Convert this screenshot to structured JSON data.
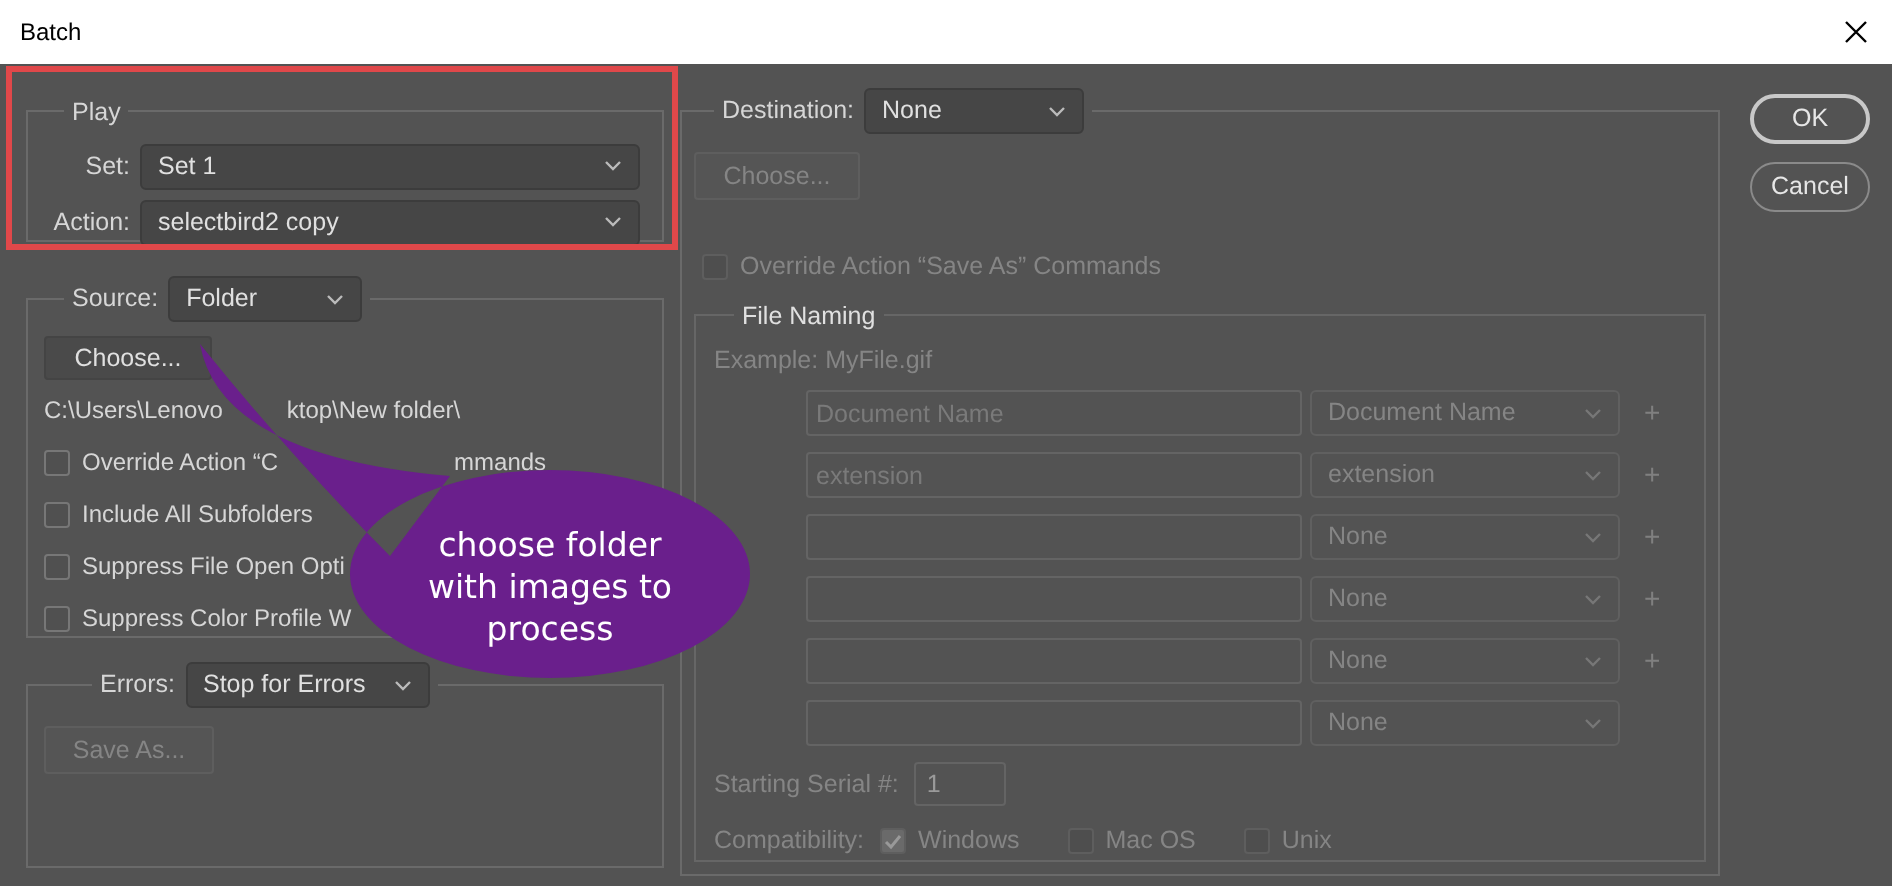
{
  "window": {
    "title": "Batch"
  },
  "play": {
    "legend": "Play",
    "set": {
      "label": "Set:",
      "value": "Set 1"
    },
    "action": {
      "label": "Action:",
      "value": "selectbird2 copy"
    }
  },
  "source": {
    "label": "Source:",
    "value": "Folder",
    "choose": "Choose...",
    "path_parts": [
      "C:\\Users\\Lenovo",
      "ktop\\New folder\\"
    ],
    "options": [
      {
        "label_parts": [
          "Override Action “C",
          "mmands"
        ],
        "checked": false
      },
      {
        "label_parts": [
          "Include All Subfolders"
        ],
        "checked": false
      },
      {
        "label_parts": [
          "Suppress File Open Opti"
        ],
        "checked": false
      },
      {
        "label_parts": [
          "Suppress Color Profile W"
        ],
        "checked": false
      }
    ]
  },
  "errors": {
    "label": "Errors:",
    "value": "Stop for Errors",
    "save_as": {
      "label": "Save As...",
      "disabled": true
    }
  },
  "destination": {
    "label": "Destination:",
    "value": "None",
    "choose": {
      "label": "Choose...",
      "disabled": true
    },
    "override": {
      "label": "Override Action “Save As” Commands",
      "checked": false,
      "disabled": true
    },
    "file_naming": {
      "legend": "File Naming",
      "example": "Example: MyFile.gif",
      "disabled": true,
      "rows": [
        {
          "placeholder": "Document Name",
          "value": "Document Name",
          "plus": "+"
        },
        {
          "placeholder": "extension",
          "value": "extension",
          "plus": "+"
        },
        {
          "value": "None",
          "plus": "+"
        },
        {
          "value": "None",
          "plus": "+"
        },
        {
          "value": "None",
          "plus": "+"
        },
        {
          "value": "None"
        }
      ]
    },
    "serial": {
      "label": "Starting Serial #:",
      "value": "1"
    },
    "compatibility": {
      "label": "Compatibility:",
      "options": [
        {
          "label": "Windows",
          "checked": true
        },
        {
          "label": "Mac OS",
          "checked": false
        },
        {
          "label": "Unix",
          "checked": false
        }
      ]
    }
  },
  "buttons": [
    {
      "label": "OK",
      "default": true
    },
    {
      "label": "Cancel",
      "default": false
    }
  ],
  "callout": {
    "text": "choose folder with images to process"
  }
}
